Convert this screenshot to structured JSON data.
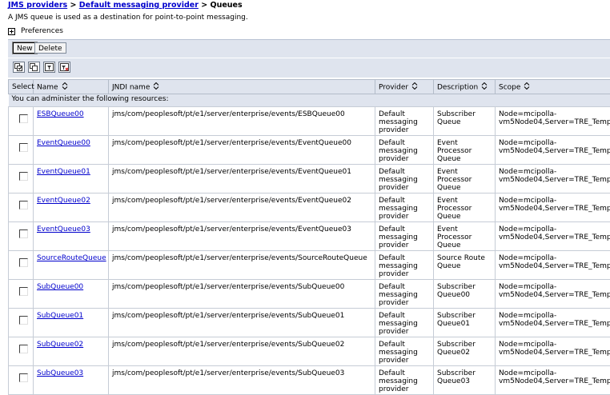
{
  "breadcrumb": {
    "item1": "JMS providers",
    "item2": "Default messaging provider",
    "current": "Queues",
    "separator": ">"
  },
  "description": "A JMS queue is used as a destination for point-to-point messaging.",
  "preferences_label": "Preferences",
  "buttons": {
    "new": "New",
    "delete": "Delete"
  },
  "table": {
    "headers": {
      "select": "Select",
      "name": "Name",
      "jndi": "JNDI name",
      "provider": "Provider",
      "description": "Description",
      "scope": "Scope"
    },
    "info": "You can administer the following resources:",
    "rows": [
      {
        "name": "ESBQueue00",
        "jndi": "jms/com/peoplesoft/pt/e1/server/enterprise/events/ESBQueue00",
        "provider": "Default messaging provider",
        "description": "Subscriber Queue",
        "scope": "Node=mcipolla-vm5Node04,Server=TRE_Temp"
      },
      {
        "name": "EventQueue00",
        "jndi": "jms/com/peoplesoft/pt/e1/server/enterprise/events/EventQueue00",
        "provider": "Default messaging provider",
        "description": "Event Processor Queue",
        "scope": "Node=mcipolla-vm5Node04,Server=TRE_Temp"
      },
      {
        "name": "EventQueue01",
        "jndi": "jms/com/peoplesoft/pt/e1/server/enterprise/events/EventQueue01",
        "provider": "Default messaging provider",
        "description": "Event Processor Queue",
        "scope": "Node=mcipolla-vm5Node04,Server=TRE_Temp"
      },
      {
        "name": "EventQueue02",
        "jndi": "jms/com/peoplesoft/pt/e1/server/enterprise/events/EventQueue02",
        "provider": "Default messaging provider",
        "description": "Event Processor Queue",
        "scope": "Node=mcipolla-vm5Node04,Server=TRE_Temp"
      },
      {
        "name": "EventQueue03",
        "jndi": "jms/com/peoplesoft/pt/e1/server/enterprise/events/EventQueue03",
        "provider": "Default messaging provider",
        "description": "Event Processor Queue",
        "scope": "Node=mcipolla-vm5Node04,Server=TRE_Temp"
      },
      {
        "name": "SourceRouteQueue",
        "jndi": "jms/com/peoplesoft/pt/e1/server/enterprise/events/SourceRouteQueue",
        "provider": "Default messaging provider",
        "description": "Source Route Queue",
        "scope": "Node=mcipolla-vm5Node04,Server=TRE_Temp"
      },
      {
        "name": "SubQueue00",
        "jndi": "jms/com/peoplesoft/pt/e1/server/enterprise/events/SubQueue00",
        "provider": "Default messaging provider",
        "description": "Subscriber Queue00",
        "scope": "Node=mcipolla-vm5Node04,Server=TRE_Temp"
      },
      {
        "name": "SubQueue01",
        "jndi": "jms/com/peoplesoft/pt/e1/server/enterprise/events/SubQueue01",
        "provider": "Default messaging provider",
        "description": "Subscriber Queue01",
        "scope": "Node=mcipolla-vm5Node04,Server=TRE_Temp"
      },
      {
        "name": "SubQueue02",
        "jndi": "jms/com/peoplesoft/pt/e1/server/enterprise/events/SubQueue02",
        "provider": "Default messaging provider",
        "description": "Subscriber Queue02",
        "scope": "Node=mcipolla-vm5Node04,Server=TRE_Temp"
      },
      {
        "name": "SubQueue03",
        "jndi": "jms/com/peoplesoft/pt/e1/server/enterprise/events/SubQueue03",
        "provider": "Default messaging provider",
        "description": "Subscriber Queue03",
        "scope": "Node=mcipolla-vm5Node04,Server=TRE_Temp"
      }
    ]
  },
  "icons": [
    "select-all-icon",
    "deselect-all-icon",
    "show-filter-icon",
    "clear-filter-icon",
    "expand-icon",
    "sort-icon"
  ],
  "colors": {
    "link": "#0000cc",
    "header_bg": "#dfe4ee",
    "border": "#c6ccd6"
  }
}
